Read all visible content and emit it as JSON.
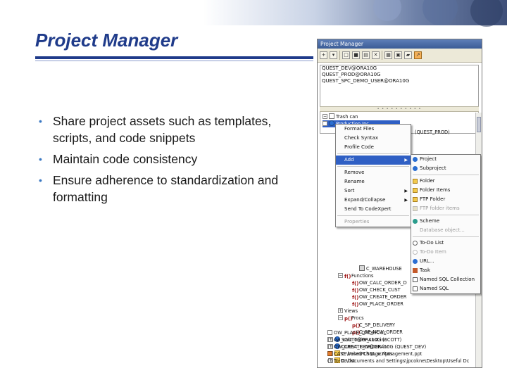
{
  "slide": {
    "title": "Project Manager",
    "bullets": [
      "Share project assets such as templates, scripts, and code snippets",
      "Maintain code consistency",
      "Ensure adherence to standardization and formatting"
    ]
  },
  "window": {
    "title": "Project Manager",
    "connections": [
      "QUEST_DEV@ORA10G",
      "QUEST_PROD@ORA10G",
      "QUEST_SPC_DEMO_USER@ORA10G"
    ],
    "tree": {
      "trash": "Trash can",
      "project": "Production Inc",
      "project_suffix": "(QUEST_PROD)",
      "warehouse": "C_WAREHOUSE",
      "functions": "Functions",
      "fn_items": [
        "OW_CALC_ORDER_D",
        "OW_CHECK_CUST",
        "OW_CREATE_ORDER",
        "OW_PLACE_ORDER"
      ],
      "views": "Views",
      "procs": "Procs",
      "proc_items": [
        "C_SP_DELIVERY",
        "C_SP_NEW_ORDER"
      ],
      "tail": [
        "SCOTT@ORA10G (SCOTT)",
        "QUEST_DEV@ORA10G (QUEST_DEV)",
        "C:\\Vohn\\PLSQL scripts",
        "C:\\Documents and Settings\\jpcokne\\Desktop\\Useful Dc",
        "OW_PLACE_ORDER.inc",
        "ow_calc_order_cost.inc",
        "OW_CREATE_ORDER.inc",
        "CASE based Change Management.ppt",
        "To-Do list"
      ]
    },
    "context_menu": [
      {
        "label": "Format Files",
        "disabled": false
      },
      {
        "label": "Check Syntax",
        "disabled": false
      },
      {
        "label": "Profile Code",
        "disabled": false
      },
      {
        "label": "Add",
        "highlight": true,
        "submenu": true
      },
      {
        "label": "Remove",
        "disabled": false
      },
      {
        "label": "Rename",
        "disabled": false
      },
      {
        "label": "Sort",
        "submenu": true
      },
      {
        "label": "Expand/Collapse",
        "submenu": true
      },
      {
        "label": "Send To CodeXpert",
        "disabled": false
      },
      {
        "label": "Properties",
        "disabled": true
      }
    ],
    "add_submenu": [
      {
        "label": "Project",
        "icon": "project-icon"
      },
      {
        "label": "Subproject",
        "icon": "subproject-icon"
      },
      {
        "label": "Folder",
        "icon": "folder-icon"
      },
      {
        "label": "Folder Items",
        "icon": "folder-items-icon"
      },
      {
        "label": "FTP Folder",
        "icon": "ftp-folder-icon"
      },
      {
        "label": "FTP folder items",
        "icon": "ftp-items-icon",
        "disabled": true
      },
      {
        "label": "Scheme",
        "icon": "schema-icon"
      },
      {
        "label": "Database object...",
        "icon": "",
        "disabled": true
      },
      {
        "label": "To-Do List",
        "icon": "todo-icon"
      },
      {
        "label": "To-Do Item",
        "icon": "todo-item-icon",
        "disabled": true
      },
      {
        "label": "URL...",
        "icon": "url-icon"
      },
      {
        "label": "Task",
        "icon": "task-icon"
      },
      {
        "label": "Named SQL Collection",
        "icon": "sql-collection-icon"
      },
      {
        "label": "Named SQL",
        "icon": "named-sql-icon"
      }
    ]
  }
}
